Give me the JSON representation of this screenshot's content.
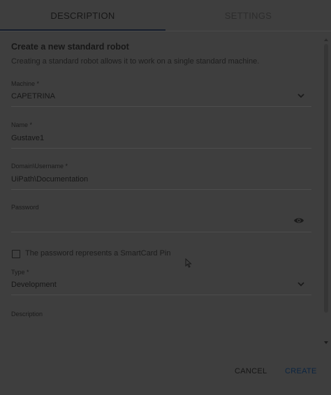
{
  "tabs": [
    {
      "label": "DESCRIPTION",
      "active": true
    },
    {
      "label": "SETTINGS",
      "active": false
    }
  ],
  "form": {
    "heading": "Create a new standard robot",
    "subheading": "Creating a standard robot allows it to work on a single standard machine.",
    "machine": {
      "label": "Machine *",
      "value": "CAPETRINA",
      "icon": "chevron-down-icon"
    },
    "name": {
      "label": "Name *",
      "value": "Gustave1"
    },
    "domain_username": {
      "label": "Domain\\Username *",
      "value": "UiPath\\Documentation"
    },
    "password": {
      "label": "Password",
      "value": "",
      "icon": "eye-icon"
    },
    "smartcard": {
      "label": "The password represents a SmartCard Pin",
      "checked": false
    },
    "type": {
      "label": "Type *",
      "value": "Development",
      "icon": "chevron-down-icon"
    },
    "description": {
      "label": "Description",
      "value": ""
    }
  },
  "actions": {
    "cancel_label": "CANCEL",
    "create_label": "CREATE"
  },
  "colors": {
    "overlay_background": "#3e3e3e",
    "primary_button_text": "#0b2440",
    "tab_indicator": "#151d2b"
  }
}
